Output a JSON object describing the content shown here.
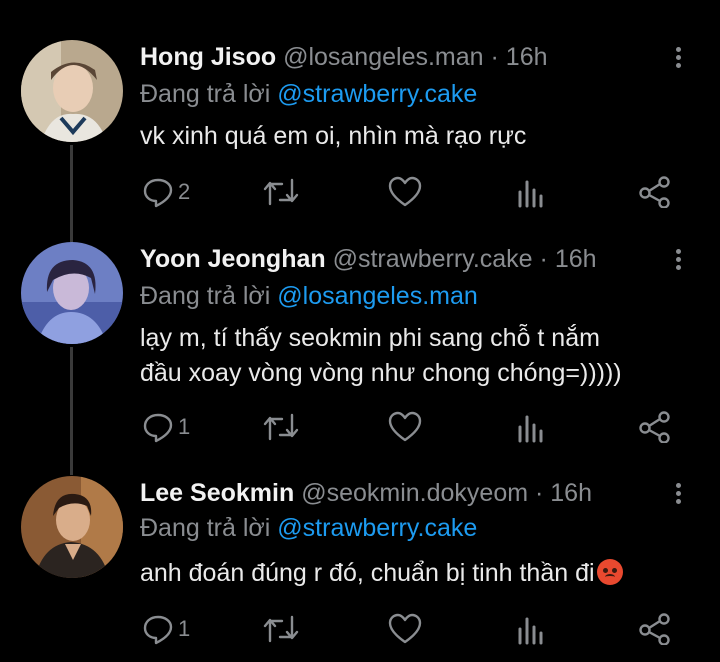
{
  "tweets": [
    {
      "name": "Hong Jisoo",
      "handle": "@losangeles.man",
      "time": "16h",
      "reply_prefix": "Đang trả lời",
      "reply_to": "@strawberry.cake",
      "text_lines": [
        "vk xinh quá em oi, nhìn mà rạo rực"
      ],
      "reply_count": "2"
    },
    {
      "name": "Yoon Jeonghan",
      "handle": "@strawberry.cake",
      "time": "16h",
      "reply_prefix": "Đang trả lời",
      "reply_to": "@losangeles.man",
      "text_lines": [
        "lạy m, tí thấy seokmin phi sang chỗ t nắm",
        "đầu xoay vòng vòng như chong chóng=)))))"
      ],
      "reply_count": "1"
    },
    {
      "name": "Lee Seokmin",
      "handle": "@seokmin.dokyeom",
      "time": "16h",
      "reply_prefix": "Đang trả lời",
      "reply_to": "@strawberry.cake",
      "text_lines": [
        "anh đoán đúng r đó, chuẩn bị tinh thần đi"
      ],
      "reply_count": "1",
      "emoji": "angry-face-emoji"
    }
  ],
  "separator": "·",
  "colors": {
    "background": "#000000",
    "mention": "#1d9bf0",
    "muted": "#8a8d91",
    "thread_line": "#3a3a3a"
  },
  "icons": [
    "reply-icon",
    "retweet-icon",
    "like-icon",
    "analytics-icon",
    "share-icon",
    "more-options-icon"
  ]
}
